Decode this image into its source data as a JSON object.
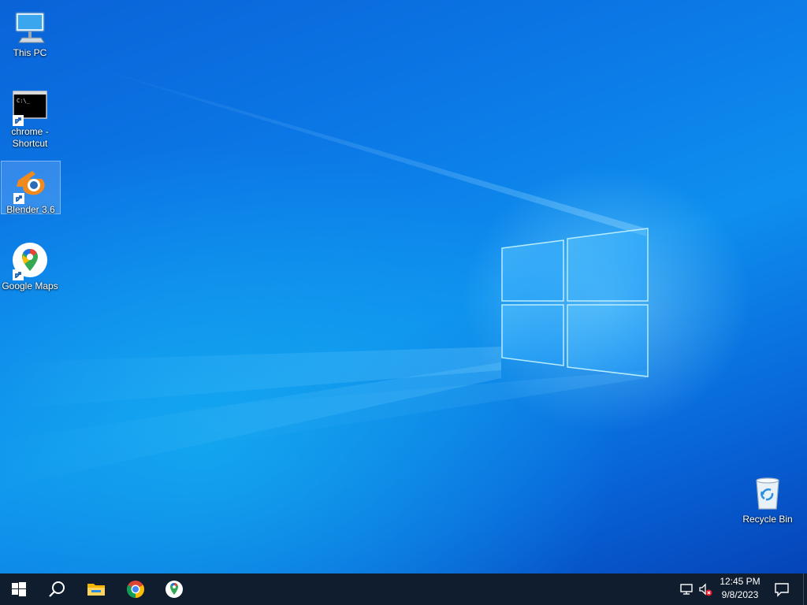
{
  "desktop": {
    "icons": [
      {
        "label": "This PC",
        "icon": "computer-icon"
      },
      {
        "label": "chrome - Shortcut",
        "icon": "command-prompt-icon"
      },
      {
        "label": "Blender 3.6",
        "icon": "blender-icon"
      },
      {
        "label": "Google Maps",
        "icon": "google-maps-icon"
      },
      {
        "label": "Recycle Bin",
        "icon": "recycle-bin-icon"
      }
    ],
    "selected_icon": "Blender 3.6"
  },
  "taskbar": {
    "pinned": [
      {
        "name": "Start",
        "icon": "windows-start-icon"
      },
      {
        "name": "Search",
        "icon": "search-icon"
      },
      {
        "name": "File Explorer",
        "icon": "folder-icon"
      },
      {
        "name": "Google Chrome",
        "icon": "chrome-icon"
      },
      {
        "name": "Google Maps",
        "icon": "google-maps-icon"
      }
    ],
    "tray": {
      "time": "12:45 PM",
      "date": "9/8/2023",
      "icons": [
        "network-icon",
        "volume-muted-icon",
        "notification-icon"
      ]
    }
  },
  "colors": {
    "taskbar": "#101d2e",
    "desktop_blue": "#0b78e6"
  }
}
